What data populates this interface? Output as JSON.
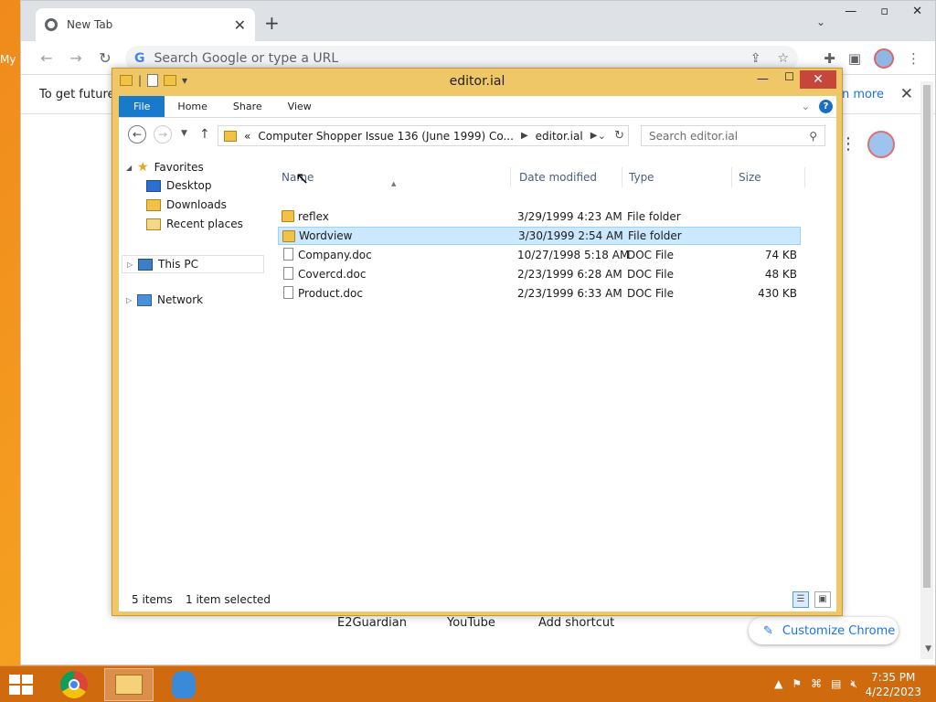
{
  "desktop": {
    "label": "My"
  },
  "chrome": {
    "tab_title": "New Tab",
    "tab_close": "✕",
    "new_tab": "+",
    "tab_menu": "⌄",
    "omnibox_placeholder": "Search Google or type a URL",
    "infobar_text": "To get future",
    "infobar_link": "rn more",
    "infobar_close": "✕",
    "shortcuts": [
      "E2Guardian",
      "YouTube",
      "Add shortcut"
    ],
    "customize_label": "Customize Chrome"
  },
  "explorer": {
    "title": "editor.ial",
    "ribbon_tabs": [
      "File",
      "Home",
      "Share",
      "View"
    ],
    "address": {
      "prefix": "«",
      "crumb1": "Computer Shopper Issue 136 (June 1999) Co...",
      "crumb2": "editor.ial"
    },
    "search_placeholder": "Search editor.ial",
    "nav": {
      "favorites": "Favorites",
      "desktop": "Desktop",
      "downloads": "Downloads",
      "recent": "Recent places",
      "this_pc": "This PC",
      "network": "Network"
    },
    "columns": {
      "name": "Name",
      "date": "Date modified",
      "type": "Type",
      "size": "Size"
    },
    "files": [
      {
        "name": "reflex",
        "date": "3/29/1999 4:23 AM",
        "type": "File folder",
        "size": "",
        "kind": "folder"
      },
      {
        "name": "Wordview",
        "date": "3/30/1999 2:54 AM",
        "type": "File folder",
        "size": "",
        "kind": "folder",
        "selected": true
      },
      {
        "name": "Company.doc",
        "date": "10/27/1998 5:18 AM",
        "type": "DOC File",
        "size": "74 KB",
        "kind": "doc"
      },
      {
        "name": "Covercd.doc",
        "date": "2/23/1999 6:28 AM",
        "type": "DOC File",
        "size": "48 KB",
        "kind": "doc"
      },
      {
        "name": "Product.doc",
        "date": "2/23/1999 6:33 AM",
        "type": "DOC File",
        "size": "430 KB",
        "kind": "doc"
      }
    ],
    "status": {
      "items": "5 items",
      "selected": "1 item selected"
    }
  },
  "taskbar": {
    "time": "7:35 PM",
    "date": "4/22/2023"
  },
  "colors": {
    "accent_file_tab": "#1979ca",
    "selection": "#cce8ff",
    "window_frame": "#f0c766",
    "close_button": "#c7463c",
    "taskbar": "#d06a0f"
  }
}
